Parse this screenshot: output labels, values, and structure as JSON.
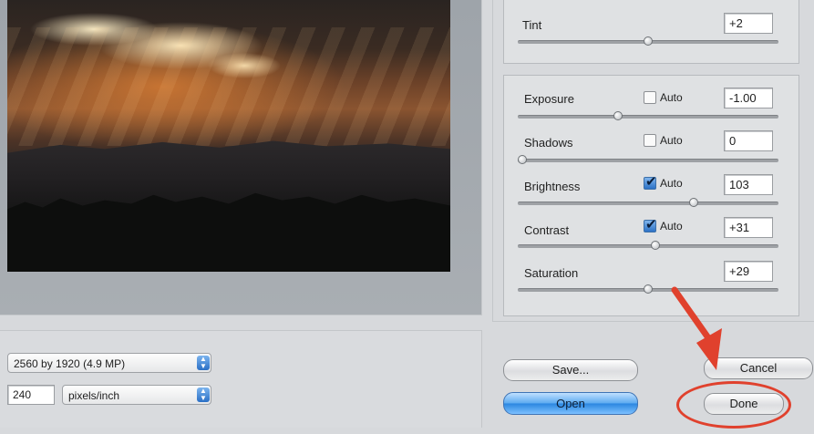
{
  "adjustments": {
    "tint": {
      "label": "Tint",
      "value": "+2",
      "slider_level": 0.5
    },
    "exposure": {
      "label": "Exposure",
      "auto_label": "Auto",
      "auto_checked": false,
      "value": "-1.00",
      "slider_level": 0.38
    },
    "shadows": {
      "label": "Shadows",
      "auto_label": "Auto",
      "auto_checked": false,
      "value": "0",
      "slider_level": 0.0
    },
    "brightness": {
      "label": "Brightness",
      "auto_label": "Auto",
      "auto_checked": true,
      "value": "103",
      "slider_level": 0.68
    },
    "contrast": {
      "label": "Contrast",
      "auto_label": "Auto",
      "auto_checked": true,
      "value": "+31",
      "slider_level": 0.53
    },
    "saturation": {
      "label": "Saturation",
      "value": "+29",
      "slider_level": 0.5
    }
  },
  "output": {
    "size_option": "2560 by 1920  (4.9 MP)",
    "resolution_value": "240",
    "resolution_unit": "pixels/inch"
  },
  "buttons": {
    "save": "Save...",
    "open": "Open",
    "cancel": "Cancel",
    "done": "Done"
  },
  "colors": {
    "annotation": "#e0412d",
    "primary_button": "#2a86e0"
  }
}
